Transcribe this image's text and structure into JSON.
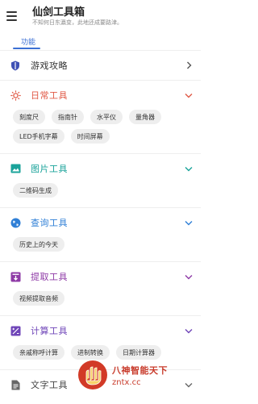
{
  "header": {
    "title": "仙剑工具箱",
    "subtitle": "不知何日东瀛变，此地还成要路津。"
  },
  "tabs": [
    {
      "label": "功能"
    }
  ],
  "sections": [
    {
      "title": "游戏攻略",
      "icon": "shield-icon",
      "color": "#3f51b5",
      "chevron": "right",
      "title_color": "#333333",
      "items": []
    },
    {
      "title": "日常工具",
      "icon": "sun-icon",
      "color": "#e05a47",
      "chevron": "down",
      "title_color": "#e05a47",
      "items": [
        "刻度尺",
        "指南针",
        "水平仪",
        "量角器",
        "LED手机字幕",
        "时间屏幕"
      ]
    },
    {
      "title": "图片工具",
      "icon": "image-icon",
      "color": "#1aa39a",
      "chevron": "down",
      "title_color": "#1aa39a",
      "items": [
        "二维码生成"
      ]
    },
    {
      "title": "查询工具",
      "icon": "globe-icon",
      "color": "#2f7fd6",
      "chevron": "down",
      "title_color": "#2f7fd6",
      "items": [
        "历史上的今天"
      ]
    },
    {
      "title": "提取工具",
      "icon": "extract-icon",
      "color": "#8e3aa6",
      "chevron": "down",
      "title_color": "#8e3aa6",
      "items": [
        "视频提取音频"
      ]
    },
    {
      "title": "计算工具",
      "icon": "calculator-icon",
      "color": "#6f45b8",
      "chevron": "down",
      "title_color": "#6f45b8",
      "items": [
        "亲戚称呼计算",
        "进制转换",
        "日期计算器"
      ]
    },
    {
      "title": "文字工具",
      "icon": "document-icon",
      "color": "#666666",
      "chevron": "down",
      "title_color": "#444444",
      "items": []
    }
  ],
  "watermark": {
    "name": "八神智能天下",
    "url": "zntx.cc"
  }
}
